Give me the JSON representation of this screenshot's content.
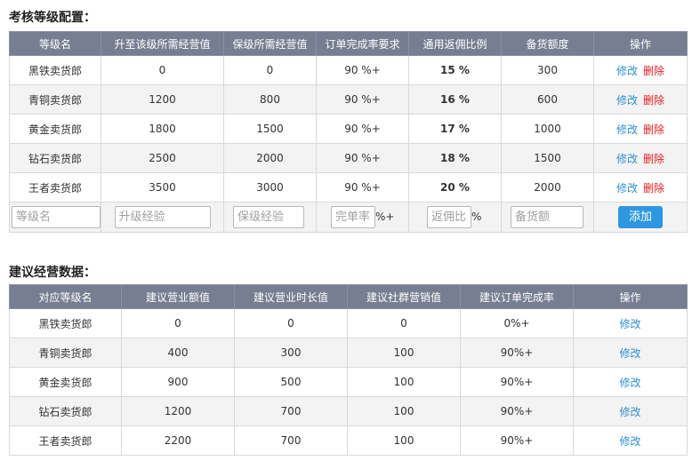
{
  "section1": {
    "title": "考核等级配置：",
    "headers": [
      "等级名",
      "升至该级所需经营值",
      "保级所需经营值",
      "订单完成率要求",
      "通用返佣比例",
      "备货额度",
      "操作"
    ],
    "rows": [
      {
        "name": "黑铁卖货郎",
        "upgrade": "0",
        "keep": "0",
        "order_rate": "90 %+",
        "rebate": "15 %",
        "stock": "300"
      },
      {
        "name": "青铜卖货郎",
        "upgrade": "1200",
        "keep": "800",
        "order_rate": "90 %+",
        "rebate": "16 %",
        "stock": "600"
      },
      {
        "name": "黄金卖货郎",
        "upgrade": "1800",
        "keep": "1500",
        "order_rate": "90 %+",
        "rebate": "17 %",
        "stock": "1000"
      },
      {
        "name": "钻石卖货郎",
        "upgrade": "2500",
        "keep": "2000",
        "order_rate": "90 %+",
        "rebate": "18 %",
        "stock": "1500"
      },
      {
        "name": "王者卖货郎",
        "upgrade": "3500",
        "keep": "3000",
        "order_rate": "90 %+",
        "rebate": "20 %",
        "stock": "2000"
      }
    ],
    "edit_label": "修改",
    "delete_label": "删除",
    "form": {
      "name_placeholder": "等级名",
      "upgrade_placeholder": "升级经验",
      "keep_placeholder": "保级经验",
      "rate_placeholder": "完单率",
      "rate_suffix": "%+",
      "rebate_placeholder": "返佣比",
      "rebate_suffix": "%",
      "stock_placeholder": "备货额",
      "add_label": "添加"
    }
  },
  "section2": {
    "title": "建议经营数据：",
    "headers": [
      "对应等级名",
      "建议营业额值",
      "建议营业时长值",
      "建议社群营销值",
      "建议订单完成率",
      "操作"
    ],
    "rows": [
      {
        "name": "黑铁卖货郎",
        "revenue": "0",
        "hours": "0",
        "community": "0",
        "order_rate": "0%+"
      },
      {
        "name": "青铜卖货郎",
        "revenue": "400",
        "hours": "300",
        "community": "100",
        "order_rate": "90%+"
      },
      {
        "name": "黄金卖货郎",
        "revenue": "900",
        "hours": "500",
        "community": "100",
        "order_rate": "90%+"
      },
      {
        "name": "钻石卖货郎",
        "revenue": "1200",
        "hours": "700",
        "community": "100",
        "order_rate": "90%+"
      },
      {
        "name": "王者卖货郎",
        "revenue": "2200",
        "hours": "700",
        "community": "100",
        "order_rate": "90%+"
      }
    ],
    "edit_label": "修改"
  }
}
